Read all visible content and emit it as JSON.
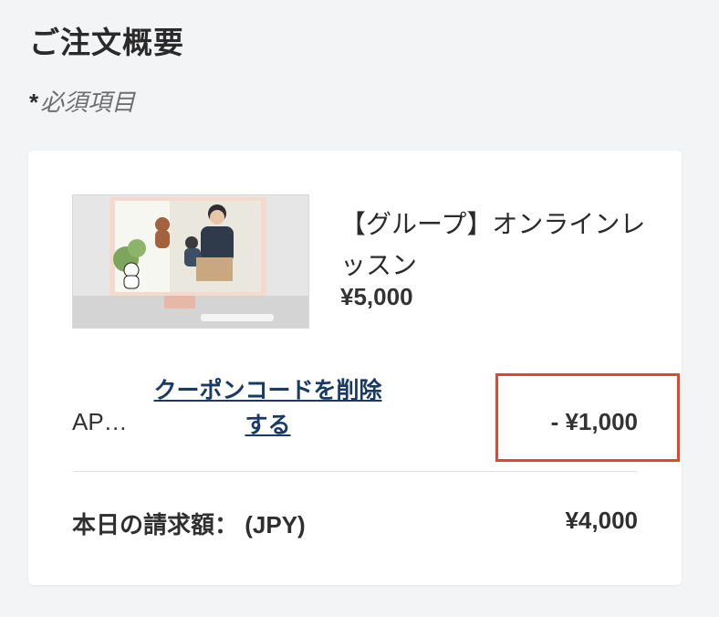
{
  "page": {
    "title": "ご注文概要",
    "required_star": "*",
    "required_text": "必須項目"
  },
  "product": {
    "name": "【グループ】オンラインレッスン",
    "price": "¥5,000",
    "image_alt": "product-thumbnail"
  },
  "coupon": {
    "code": "AP…",
    "remove_label": "クーポンコードを削除する",
    "discount": "- ¥1,000"
  },
  "total": {
    "label": "本日の請求額： (JPY)",
    "value": "¥4,000"
  },
  "colors": {
    "background": "#f3f4f6",
    "card": "#ffffff",
    "link": "#1a3a66",
    "highlight_border": "#e5442f"
  }
}
